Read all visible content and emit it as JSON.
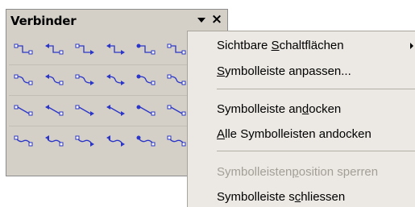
{
  "toolbar": {
    "title": "Verbinder",
    "dropdown_icon": "dropdown-arrow-icon",
    "close_label": "×",
    "icon_color": "#2b35c8",
    "rows": [
      {
        "type": "elbow",
        "buttons": [
          "elbow-connector",
          "elbow-arrow-connector",
          "elbow-double-arrow-connector",
          "elbow-arrows-both-connector",
          "elbow-dot-connector",
          "elbow-connector-variant",
          "elbow-connector-variant-2",
          "elbow-connector-variant-3",
          "elbow-connector-variant-4"
        ]
      },
      {
        "type": "curved",
        "buttons": [
          "curved-connector",
          "curved-arrow-connector",
          "curved-double-arrow-connector",
          "curved-arrows-both-connector",
          "curved-dot-connector",
          "curved-connector-variant",
          "curved-connector-variant-2",
          "curved-connector-variant-3",
          "curved-connector-variant-4"
        ]
      },
      {
        "type": "straight",
        "buttons": [
          "straight-connector",
          "straight-arrow-connector",
          "straight-double-arrow-connector",
          "straight-arrows-both-connector",
          "straight-dot-connector",
          "straight-connector-variant",
          "straight-connector-variant-2",
          "straight-connector-variant-3",
          "straight-connector-variant-4"
        ]
      },
      {
        "type": "wave",
        "buttons": [
          "wave-connector",
          "wave-arrow-connector",
          "wave-double-arrow-connector",
          "wave-arrows-both-connector",
          "wave-dot-connector",
          "wave-connector-variant",
          "wave-connector-variant-2",
          "wave-connector-variant-3",
          "wave-connector-variant-4"
        ]
      }
    ]
  },
  "context_menu": {
    "items": [
      {
        "pre": "Sichtbare ",
        "ul": "S",
        "post": "chaltflächen",
        "submenu": true,
        "disabled": false
      },
      {
        "pre": "",
        "ul": "S",
        "post": "ymbolleiste anpassen...",
        "submenu": false,
        "disabled": false
      },
      {
        "pre": "Symbolleiste an",
        "ul": "d",
        "post": "ocken",
        "submenu": false,
        "disabled": false
      },
      {
        "pre": "",
        "ul": "A",
        "post": "lle Symbolleisten andocken",
        "submenu": false,
        "disabled": false
      },
      {
        "pre": "Symbolleisten",
        "ul": "p",
        "post": "osition sperren",
        "submenu": false,
        "disabled": true
      },
      {
        "pre": "Symbolleiste s",
        "ul": "c",
        "post": "hliessen",
        "submenu": false,
        "disabled": false
      }
    ]
  }
}
